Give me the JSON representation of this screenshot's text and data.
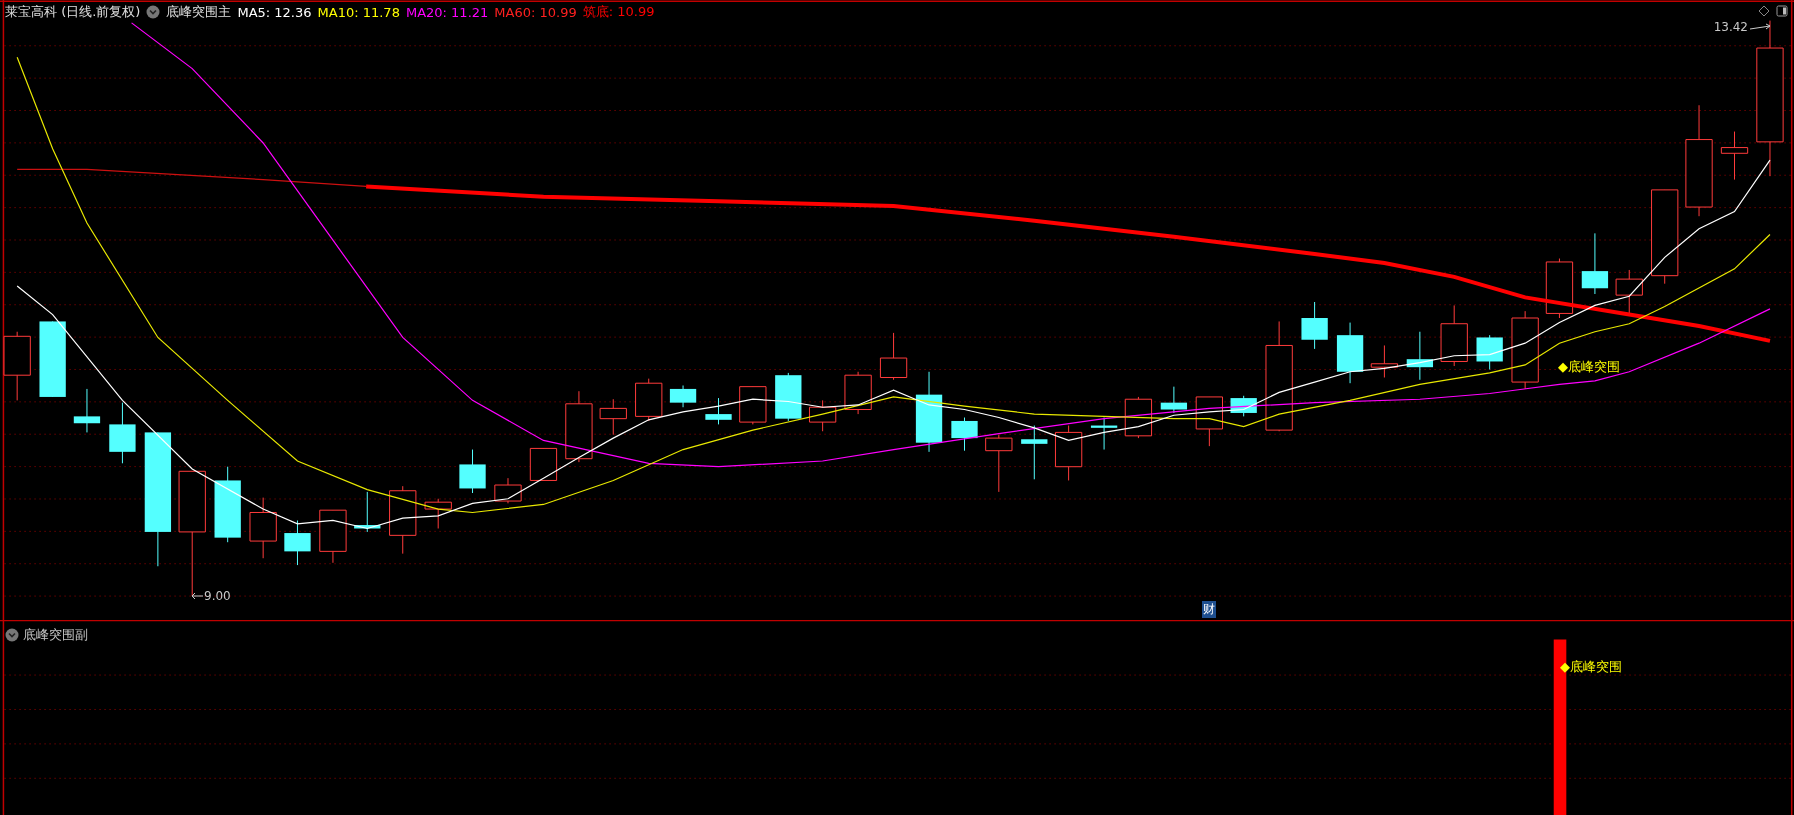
{
  "header": {
    "stock": "莱宝高科 (日线.前复权)",
    "indicator": "底峰突围主",
    "values": [
      {
        "label": "MA5: 12.36",
        "color": "#ffffff"
      },
      {
        "label": "MA10: 11.78",
        "color": "#ffff00"
      },
      {
        "label": "MA20: 11.21",
        "color": "#ff00ff"
      },
      {
        "label": "MA60: 10.99",
        "color": "#ff2020"
      },
      {
        "label": "筑底: 10.99",
        "color": "#ff0000"
      }
    ]
  },
  "price_labels": {
    "high": "13.42",
    "low": "9.00"
  },
  "finance_badge": "财",
  "main_signal": "◆底峰突围",
  "sub_panel": {
    "indicator": "底峰突围副",
    "signal": "◆底峰突围"
  }
}
